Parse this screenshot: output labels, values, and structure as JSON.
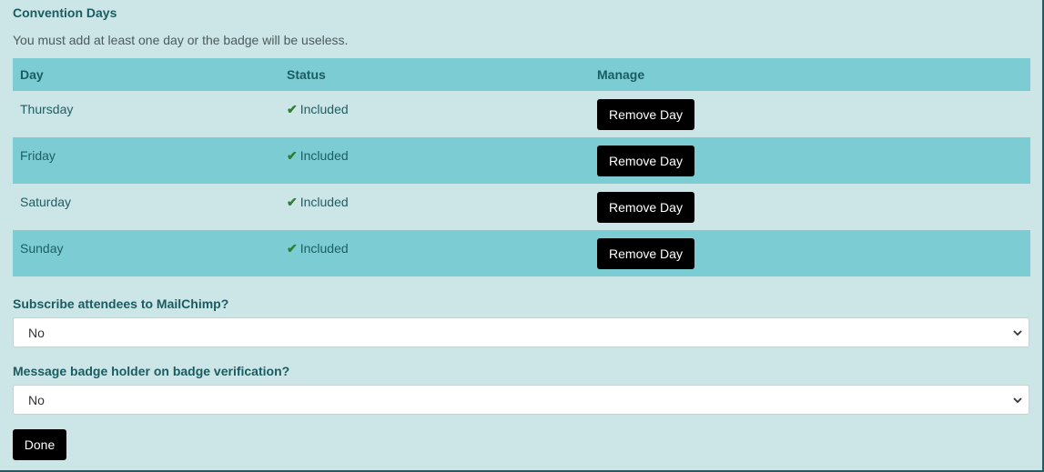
{
  "section_title": "Convention Days",
  "hint": "You must add at least one day or the badge will be useless.",
  "table": {
    "headers": [
      "Day",
      "Status",
      "Manage"
    ],
    "rows": [
      {
        "day": "Thursday",
        "status": "Included",
        "action": "Remove Day"
      },
      {
        "day": "Friday",
        "status": "Included",
        "action": "Remove Day"
      },
      {
        "day": "Saturday",
        "status": "Included",
        "action": "Remove Day"
      },
      {
        "day": "Sunday",
        "status": "Included",
        "action": "Remove Day"
      }
    ]
  },
  "mailchimp": {
    "label": "Subscribe attendees to MailChimp?",
    "value": "No"
  },
  "verification": {
    "label": "Message badge holder on badge verification?",
    "value": "No"
  },
  "done_label": "Done",
  "icons": {
    "status": "checkmark-icon",
    "select": "chevron-down-icon"
  },
  "colors": {
    "accent": "#7bcdd3",
    "background": "#cce5e6",
    "button": "#000000",
    "check": "#2e7d32"
  }
}
